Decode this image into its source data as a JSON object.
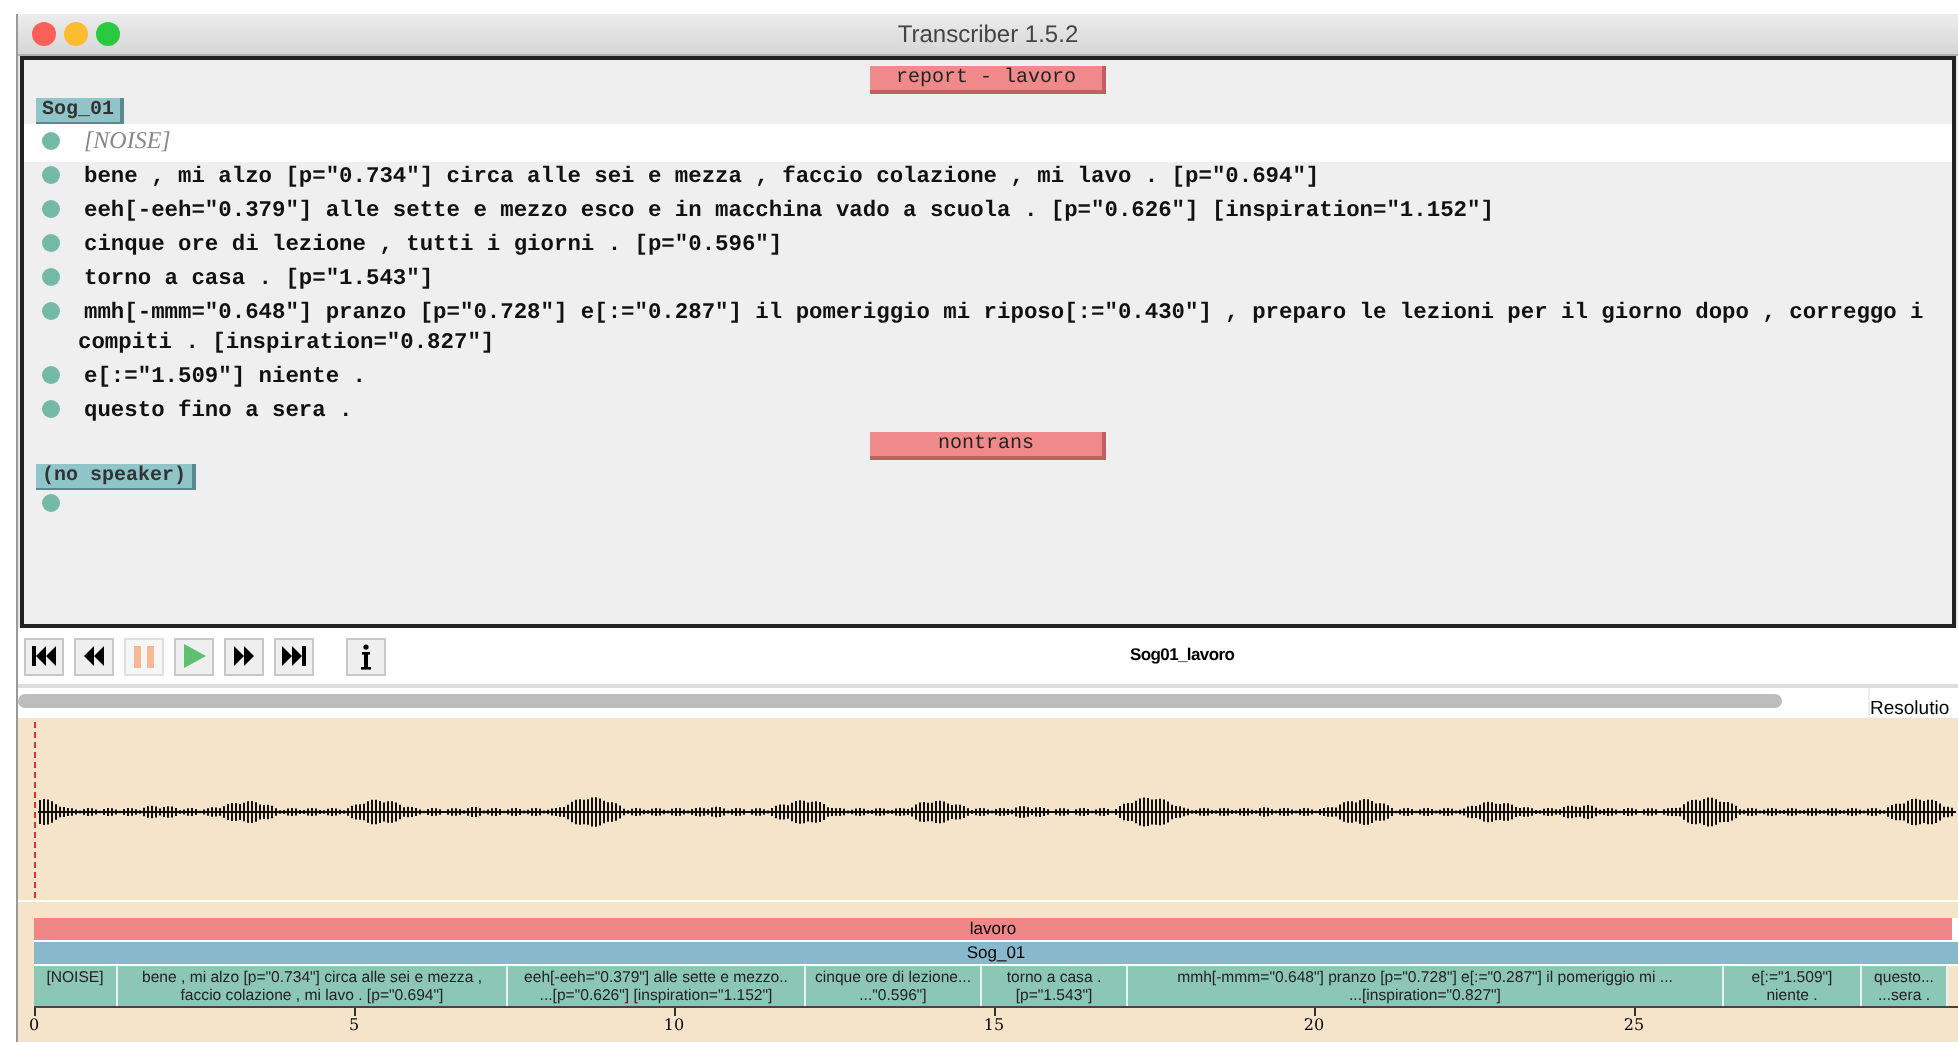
{
  "window": {
    "title": "Transcriber 1.5.2"
  },
  "editor": {
    "sections": [
      {
        "label": "report - lavoro",
        "turns": [
          {
            "speaker": "Sog_01",
            "segments": [
              {
                "kind": "noise",
                "text": "[NOISE]",
                "selected": true
              },
              {
                "kind": "speech",
                "text": "bene , mi alzo [p=\"0.734\"] circa alle sei e mezza , faccio colazione , mi lavo . [p=\"0.694\"]",
                "selected": false
              },
              {
                "kind": "speech",
                "text": "eeh[-eeh=\"0.379\"] alle sette e mezzo esco e in macchina vado a scuola . [p=\"0.626\"] [inspiration=\"1.152\"]",
                "selected": false
              },
              {
                "kind": "speech",
                "text": "cinque ore di lezione , tutti i giorni . [p=\"0.596\"]",
                "selected": false
              },
              {
                "kind": "speech",
                "text": "torno a casa . [p=\"1.543\"]",
                "selected": false
              },
              {
                "kind": "speech",
                "text": "mmh[-mmm=\"0.648\"] pranzo [p=\"0.728\"] e[:=\"0.287\"] il pomeriggio mi riposo[:=\"0.430\"] , preparo le lezioni per il giorno dopo , correggo i compiti . [inspiration=\"0.827\"]",
                "selected": false
              },
              {
                "kind": "speech",
                "text": "e[:=\"1.509\"] niente .",
                "selected": false
              },
              {
                "kind": "speech",
                "text": "questo fino a sera .",
                "selected": false
              }
            ]
          }
        ]
      },
      {
        "label": "nontrans",
        "turns": [
          {
            "speaker": "(no speaker)",
            "segments": [
              {
                "kind": "empty",
                "selected": false
              }
            ]
          }
        ]
      }
    ]
  },
  "toolbar": {
    "buttons": [
      {
        "kind": "skip_start",
        "disabled": false
      },
      {
        "kind": "rewind",
        "disabled": false
      },
      {
        "kind": "pause",
        "disabled": true
      },
      {
        "kind": "play",
        "disabled": false
      },
      {
        "kind": "forward",
        "disabled": false
      },
      {
        "kind": "skip_end",
        "disabled": false
      },
      {
        "kind": "info",
        "disabled": false
      }
    ],
    "file_name": "Sog01_lavoro"
  },
  "resolution": {
    "label": "Resolutio"
  },
  "timeline": {
    "section_tier": "lavoro",
    "speaker_tier": "Sog_01",
    "segments": [
      "[NOISE]",
      "bene , mi alzo [p=\"0.734\"] circa alle sei e mezza ,\nfaccio colazione , mi lavo . [p=\"0.694\"]",
      "eeh[-eeh=\"0.379\"] alle sette e mezzo..\n...[p=\"0.626\"] [inspiration=\"1.152\"]",
      "cinque ore di lezione...\n...\"0.596\"]",
      "torno a casa .\n[p=\"1.543\"]",
      "mmh[-mmm=\"0.648\"] pranzo [p=\"0.728\"] e[:=\"0.287\"] il pomeriggio mi ...\n...[inspiration=\"0.827\"]",
      "e[:=\"1.509\"]\nniente .",
      "questo...\n...sera ."
    ],
    "axis_labels": [
      "0",
      "5",
      "10",
      "15",
      "20",
      "25"
    ]
  }
}
